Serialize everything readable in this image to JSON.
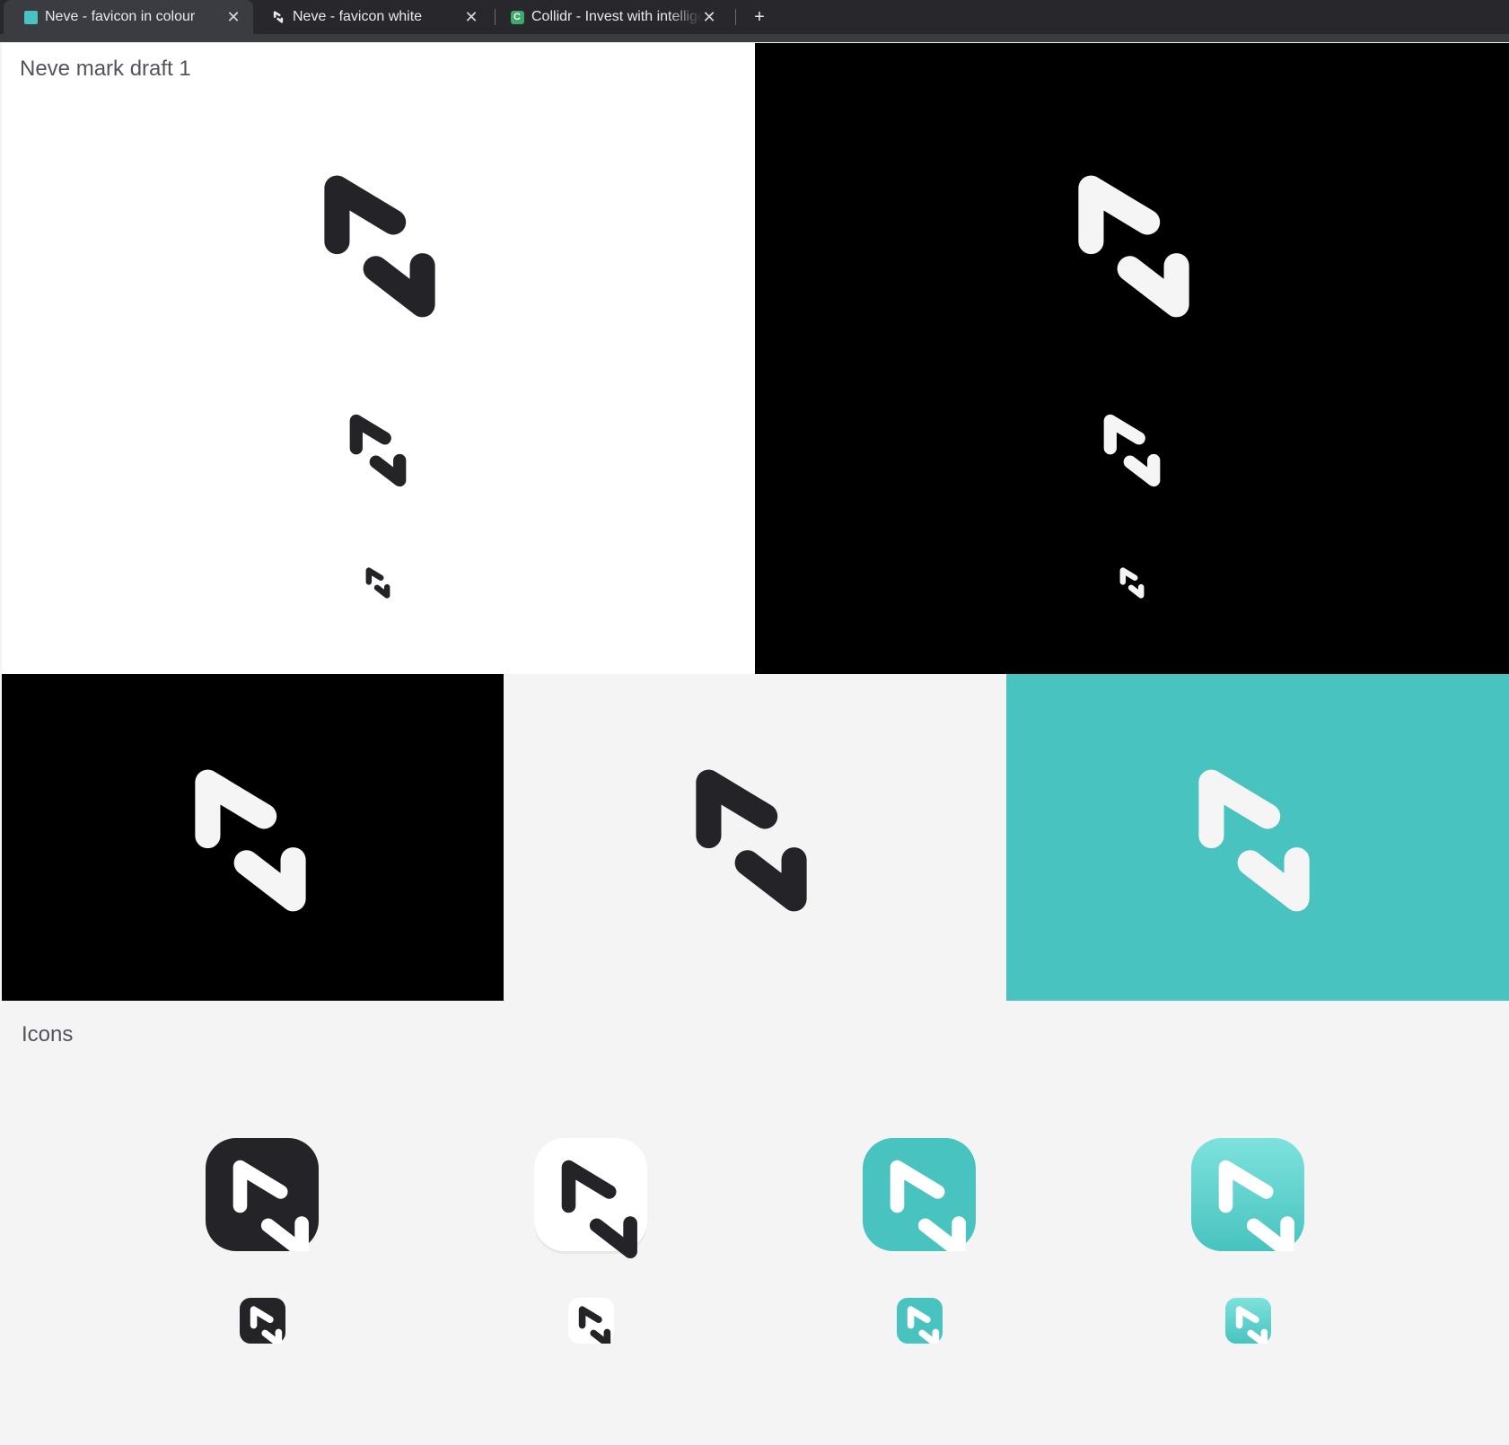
{
  "browser": {
    "tabs": [
      {
        "title": "Neve - favicon in colour",
        "active": true,
        "favicon": "teal-square-favicon"
      },
      {
        "title": "Neve - favicon white",
        "active": false,
        "favicon": "neve-mark-favicon"
      },
      {
        "title": "Collidr - Invest with intelligence",
        "active": false,
        "favicon": "collidr-c-favicon"
      }
    ],
    "close_glyph": "✕",
    "new_tab_glyph": "+"
  },
  "sections": {
    "mark_draft_heading": "Neve mark draft 1",
    "icons_heading": "Icons"
  },
  "colors": {
    "dark": "#232328",
    "white": "#ffffff",
    "black": "#000000",
    "light_grey": "#f4f4f5",
    "teal": "#48c3bf",
    "teal_gradient_top": "#7ee2dd",
    "teal_gradient_bottom": "#48c3bf",
    "mark_white": "#f5f5f5"
  }
}
